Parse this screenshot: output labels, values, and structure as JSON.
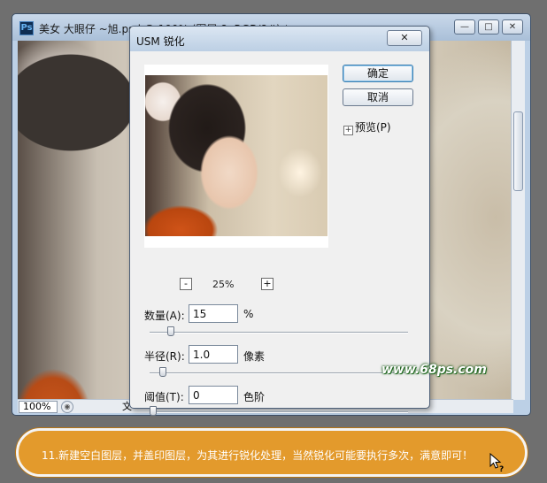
{
  "ps_window": {
    "logo": "Ps",
    "title": "美女 大眼仔 ~旭.psd @ 100% (图层 8, RGB/8#) *",
    "buttons": [
      "minimize",
      "maximize",
      "close"
    ],
    "status_zoom": "100%",
    "status_text": "文"
  },
  "dialog": {
    "title": "USM 锐化",
    "close_label": "✕",
    "ok_label": "确定",
    "cancel_label": "取消",
    "preview_label": "预览(P)",
    "preview_checked": true,
    "zoom": {
      "minus": "-",
      "value": "25%",
      "plus": "+"
    },
    "amount": {
      "label": "数量(A):",
      "value": "15",
      "unit": "%",
      "slider": 0.07
    },
    "radius": {
      "label": "半径(R):",
      "value": "1.0",
      "unit": "像素",
      "slider": 0.04
    },
    "threshold": {
      "label": "阈值(T):",
      "value": "0",
      "unit": "色阶",
      "slider": 0.0
    }
  },
  "watermark": "www.68ps.com",
  "caption": "11.新建空白图层，并盖印图层，为其进行锐化处理，当然锐化可能要执行多次，满意即可！",
  "colors": {
    "caption_bg": "#e39a2c",
    "dialog_bg": "#f0f0f0",
    "titlebar": "#bcd0e6"
  }
}
